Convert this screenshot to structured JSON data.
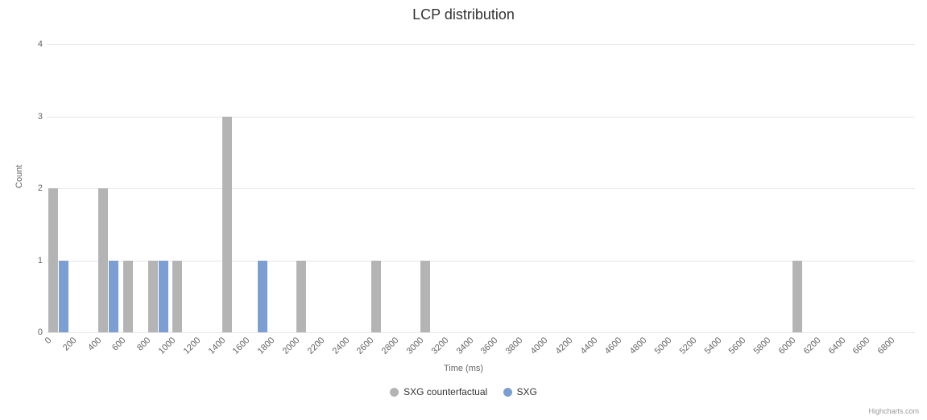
{
  "chart_data": {
    "type": "bar",
    "title": "LCP distribution",
    "xlabel": "Time (ms)",
    "ylabel": "Count",
    "ylim": [
      0,
      4
    ],
    "categories": [
      0,
      200,
      400,
      600,
      800,
      1000,
      1200,
      1400,
      1600,
      1800,
      2000,
      2200,
      2400,
      2600,
      2800,
      3000,
      3200,
      3400,
      3600,
      3800,
      4000,
      4200,
      4400,
      4600,
      4800,
      5000,
      5200,
      5400,
      5600,
      5800,
      6000,
      6200,
      6400,
      6600,
      6800
    ],
    "series": [
      {
        "name": "SXG counterfactual",
        "color": "#b4b4b4",
        "values": [
          2,
          0,
          2,
          1,
          1,
          1,
          0,
          3,
          0,
          0,
          1,
          0,
          0,
          1,
          0,
          1,
          0,
          0,
          0,
          0,
          0,
          0,
          0,
          0,
          0,
          0,
          0,
          0,
          0,
          0,
          1,
          0,
          0,
          0,
          0
        ]
      },
      {
        "name": "SXG",
        "color": "#7c9fd3",
        "values": [
          1,
          0,
          1,
          0,
          1,
          0,
          0,
          0,
          1,
          0,
          0,
          0,
          0,
          0,
          0,
          0,
          0,
          0,
          0,
          0,
          0,
          0,
          0,
          0,
          0,
          0,
          0,
          0,
          0,
          0,
          0,
          0,
          0,
          0,
          0
        ]
      }
    ],
    "credits": "Highcharts.com"
  }
}
